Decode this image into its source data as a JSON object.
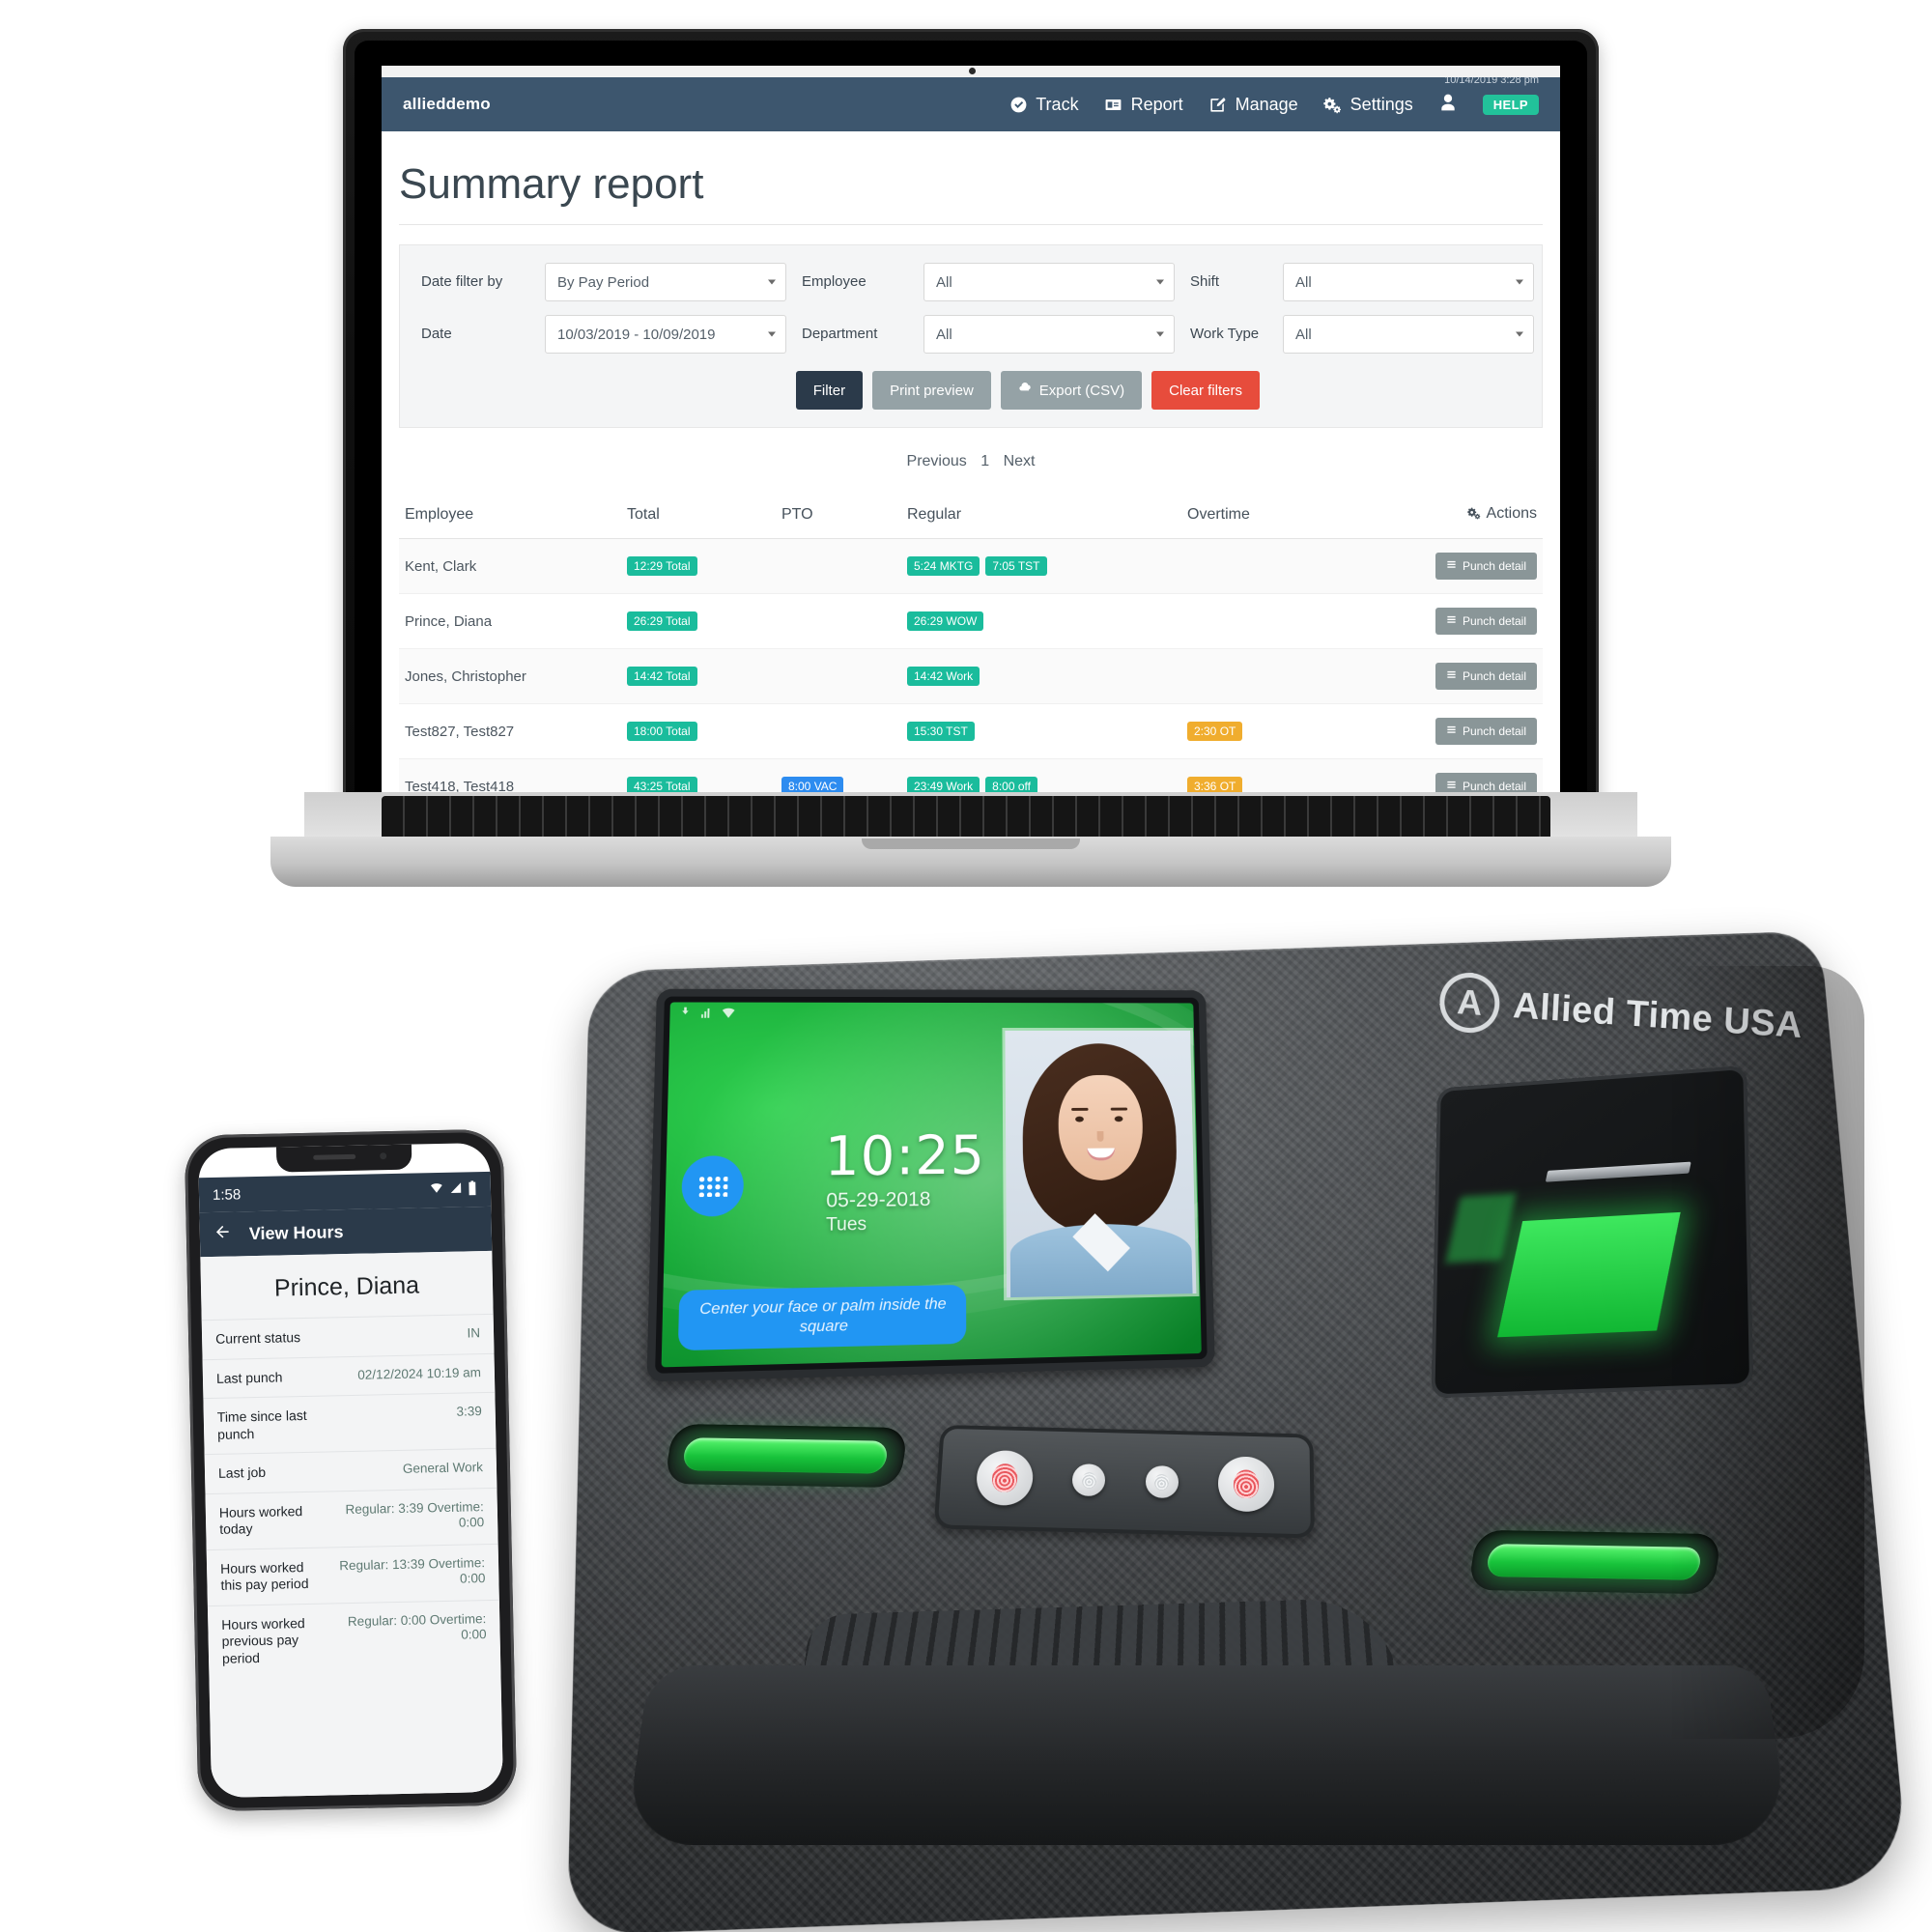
{
  "webapp": {
    "brand": "allieddemo",
    "timestamp": "10/14/2019 3:28 pm",
    "nav": [
      {
        "label": "Track",
        "icon": "check-circle-icon"
      },
      {
        "label": "Report",
        "icon": "id-card-icon"
      },
      {
        "label": "Manage",
        "icon": "pencil-square-icon"
      },
      {
        "label": "Settings",
        "icon": "gears-icon"
      }
    ],
    "help_label": "HELP",
    "page_title": "Summary report",
    "filters": {
      "date_filter_by_label": "Date filter by",
      "date_filter_by_value": "By Pay Period",
      "date_label": "Date",
      "date_value": "10/03/2019 - 10/09/2019",
      "employee_label": "Employee",
      "employee_value": "All",
      "department_label": "Department",
      "department_value": "All",
      "shift_label": "Shift",
      "shift_value": "All",
      "work_type_label": "Work Type",
      "work_type_value": "All",
      "buttons": {
        "filter": "Filter",
        "print_preview": "Print preview",
        "export_csv": "Export (CSV)",
        "clear_filters": "Clear filters"
      }
    },
    "pager": {
      "previous": "Previous",
      "page": "1",
      "next": "Next"
    },
    "table": {
      "headers": [
        "Employee",
        "Total",
        "PTO",
        "Regular",
        "Overtime",
        "Actions"
      ],
      "action_label": "Punch detail",
      "rows": [
        {
          "employee": "Kent, Clark",
          "total": [
            "12:29 Total"
          ],
          "pto": [],
          "regular": [
            "5:24 MKTG",
            "7:05 TST"
          ],
          "overtime": []
        },
        {
          "employee": "Prince, Diana",
          "total": [
            "26:29 Total"
          ],
          "pto": [],
          "regular": [
            "26:29 WOW"
          ],
          "overtime": []
        },
        {
          "employee": "Jones, Christopher",
          "total": [
            "14:42 Total"
          ],
          "pto": [],
          "regular": [
            "14:42 Work"
          ],
          "overtime": []
        },
        {
          "employee": "Test827, Test827",
          "total": [
            "18:00 Total"
          ],
          "pto": [],
          "regular": [
            "15:30 TST"
          ],
          "overtime": [
            "2:30 OT"
          ]
        },
        {
          "employee": "Test418, Test418",
          "total": [
            "43:25 Total"
          ],
          "pto": [
            "8:00 VAC"
          ],
          "regular": [
            "23:49 Work",
            "8:00 off"
          ],
          "overtime": [
            "3:36 OT"
          ]
        }
      ]
    }
  },
  "phone": {
    "status_time": "1:58",
    "appbar_title": "View Hours",
    "employee_name": "Prince, Diana",
    "rows": [
      {
        "key": "Current status",
        "value": "IN"
      },
      {
        "key": "Last punch",
        "value": "02/12/2024 10:19 am"
      },
      {
        "key": "Time since last punch",
        "value": "3:39"
      },
      {
        "key": "Last job",
        "value": "General Work"
      },
      {
        "key": "Hours worked today",
        "value": "Regular: 3:39  Overtime: 0:00"
      },
      {
        "key": "Hours worked this pay period",
        "value": "Regular: 13:39 Overtime: 0:00"
      },
      {
        "key": "Hours worked previous pay period",
        "value": "Regular: 0:00 Overtime: 0:00"
      }
    ]
  },
  "timeclock": {
    "brand": "Allied Time USA",
    "display_time": "10:25",
    "display_date": "05-29-2018",
    "display_day": "Tues",
    "display_hint": "Center your face or palm inside the square"
  },
  "colors": {
    "nav_bg": "#3d566e",
    "accent_teal": "#1abc9c",
    "help_green": "#22c29a",
    "pto_blue": "#2d8cf0",
    "ot_orange": "#f0ad2e",
    "danger_red": "#e74c3c",
    "dark_button": "#2b3a4a",
    "grey_button": "#95a2a6",
    "device_green": "#18ab39"
  }
}
